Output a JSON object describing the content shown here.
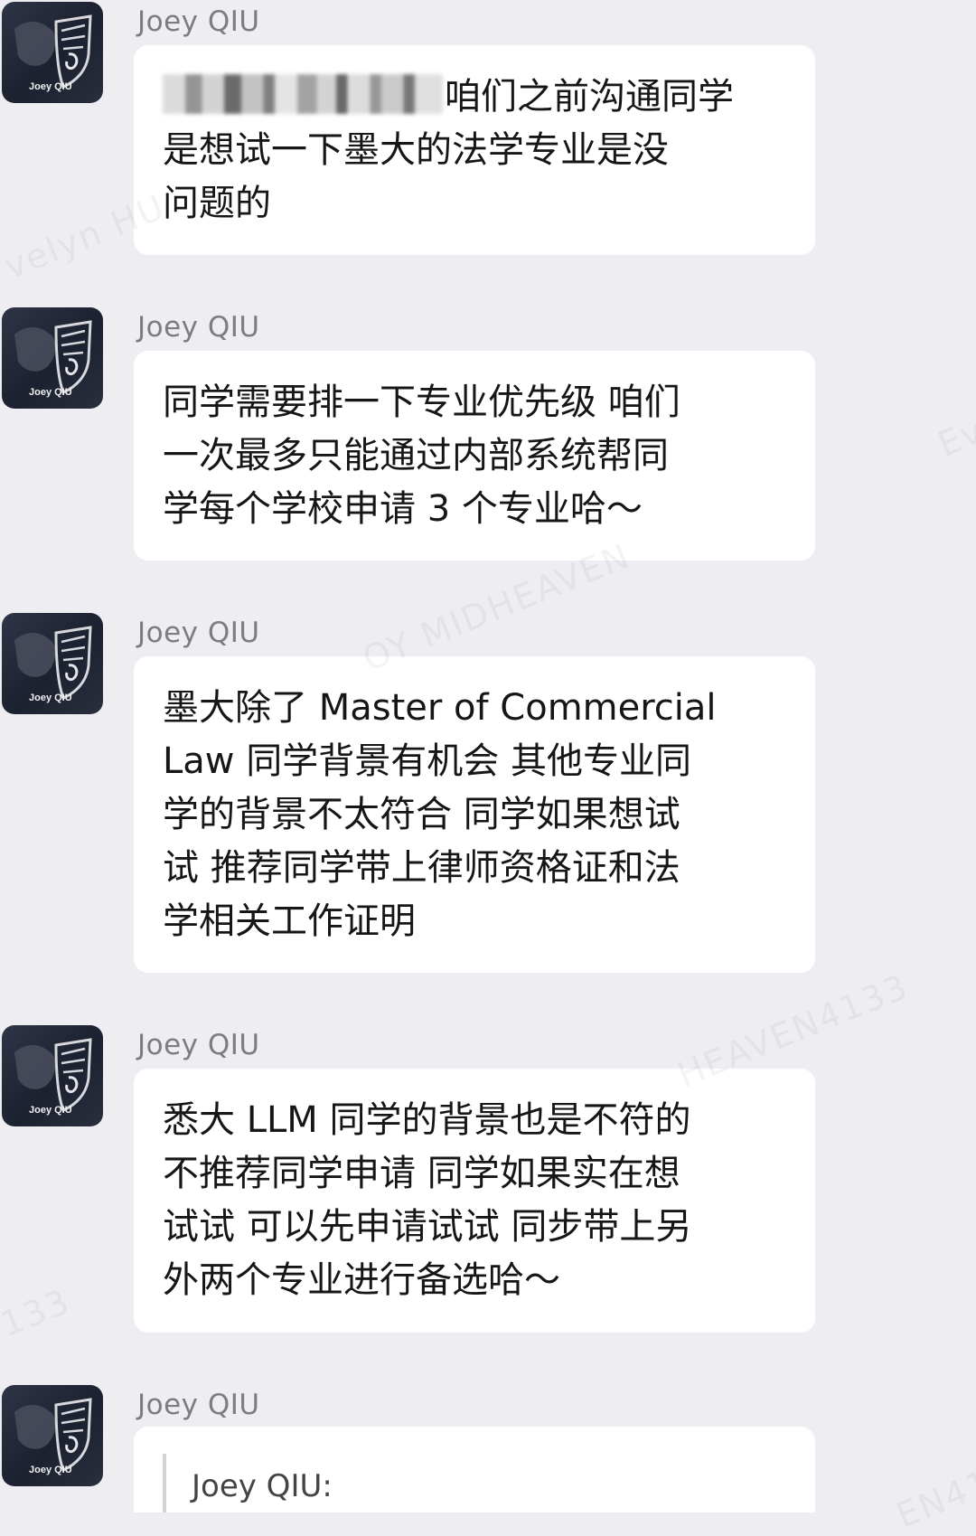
{
  "messages": [
    {
      "sender": "Joey QIU",
      "text_redacted_prefix": true,
      "text": "咱们之前沟通同学\n是想试一下墨大的法学专业是没\n问题的"
    },
    {
      "sender": "Joey QIU",
      "text": "同学需要排一下专业优先级 咱们\n一次最多只能通过内部系统帮同\n学每个学校申请 3 个专业哈～"
    },
    {
      "sender": "Joey QIU",
      "text": "墨大除了 Master of Commercial\nLaw 同学背景有机会 其他专业同\n学的背景不太符合 同学如果想试\n试 推荐同学带上律师资格证和法\n学相关工作证明"
    },
    {
      "sender": "Joey QIU",
      "text": "悉大 LLM 同学的背景也是不符的\n不推荐同学申请 同学如果实在想\n试试 可以先申请试试 同步带上另\n外两个专业进行备选哈～"
    },
    {
      "sender": "Joey QIU",
      "quote_author": "Joey QIU:"
    }
  ],
  "avatar_label": "Joey QIU",
  "watermarks": [
    "velyn HU",
    "Ev",
    "OY MIDHEAVEN",
    "HEAVEN4133",
    "133",
    "EN41"
  ],
  "colors": {
    "background": "#ededf2",
    "bubble": "#ffffff",
    "sender": "#7d7d80",
    "text": "#161616"
  }
}
